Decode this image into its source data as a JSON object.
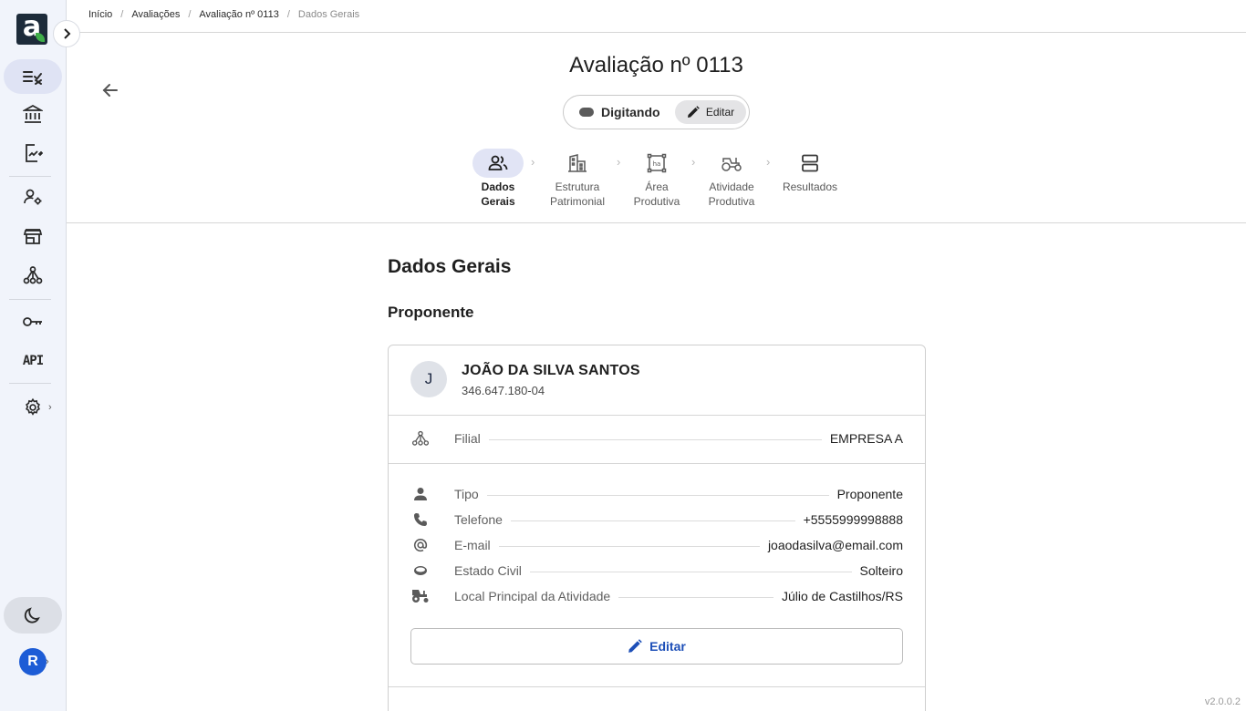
{
  "breadcrumb": {
    "items": [
      "Início",
      "Avaliações",
      "Avaliação nº 0113"
    ],
    "current": "Dados Gerais"
  },
  "header": {
    "title": "Avaliação nº 0113",
    "status": "Digitando",
    "edit_label": "Editar"
  },
  "stepper": {
    "steps": [
      {
        "label": "Dados\nGerais",
        "icon": "people-icon",
        "active": true
      },
      {
        "label": "Estrutura\nPatrimonial",
        "icon": "buildings-icon",
        "active": false
      },
      {
        "label": "Área\nProdutiva",
        "icon": "hectare-icon",
        "active": false
      },
      {
        "label": "Atividade\nProdutiva",
        "icon": "tractor-icon",
        "active": false
      },
      {
        "label": "Resultados",
        "icon": "results-icon",
        "active": false
      }
    ]
  },
  "main": {
    "section_title": "Dados Gerais",
    "subsection_title": "Proponente",
    "person": {
      "initial": "J",
      "name": "JOÃO DA SILVA SANTOS",
      "document": "346.647.180-04"
    },
    "branch": {
      "label": "Filial",
      "value": "EMPRESA A",
      "icon": "branch-icon"
    },
    "fields": [
      {
        "label": "Tipo",
        "value": "Proponente",
        "icon": "person-icon"
      },
      {
        "label": "Telefone",
        "value": "+5555999998888",
        "icon": "phone-icon"
      },
      {
        "label": "E-mail",
        "value": "joaodasilva@email.com",
        "icon": "at-icon"
      },
      {
        "label": "Estado Civil",
        "value": "Solteiro",
        "icon": "rings-icon"
      },
      {
        "label": "Local Principal da Atividade",
        "value": "Júlio de Castilhos/RS",
        "icon": "tractor-icon"
      }
    ],
    "edit_button": "Editar"
  },
  "sidebar": {
    "user_initial": "R",
    "api_label": "API",
    "items": [
      "checklist-icon",
      "bank-icon",
      "document-chart-icon",
      "user-settings-icon",
      "store-icon",
      "network-icon",
      "key-icon",
      "api-icon",
      "gear-icon"
    ]
  },
  "footer": {
    "version": "v2.0.0.2"
  },
  "colors": {
    "accent": "#1d4fb8",
    "active_bg": "#dfe3f4",
    "sidebar_bg": "#f1f4fb"
  }
}
